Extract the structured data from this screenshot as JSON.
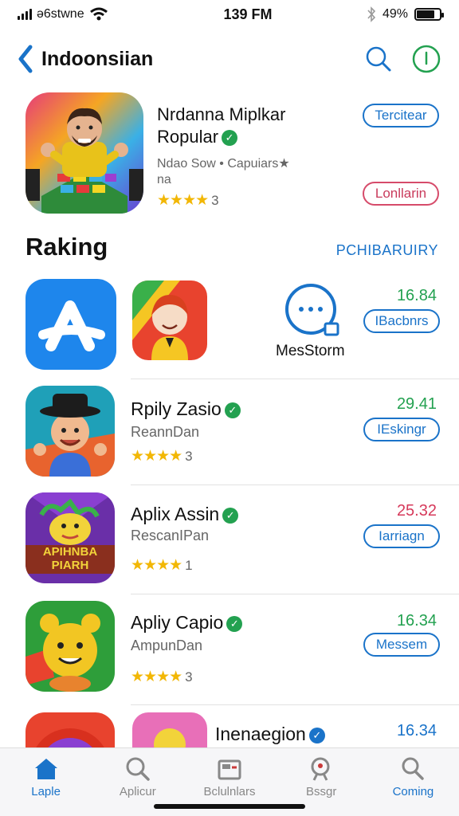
{
  "status": {
    "carrier": "ǝ6stwne",
    "time": "139 FM",
    "battery": "49%"
  },
  "nav": {
    "title": "Indoonsiian"
  },
  "featured": {
    "name_line1": "Nrdanna Miplkar",
    "name_line2": "Ropular",
    "subtitle": "Ndao Sow • Capuiars★",
    "subtitle2": "na",
    "stars": "★★★★",
    "rating": "3",
    "button_top": "Tercitear",
    "button_bottom": "Lonllarin"
  },
  "section": {
    "title": "Raking",
    "link": "PCHIBARUIRY"
  },
  "rows": [
    {
      "name": "MesStorm",
      "price": "16.84",
      "button": "IBacbnrs"
    },
    {
      "name": "Rpily Zasio",
      "developer": "ReannDan",
      "stars": "★★★★",
      "rating": "3",
      "price": "29.41",
      "button": "IEskingr"
    },
    {
      "name": "Aplix Assin",
      "developer": "RescanIPan",
      "stars": "★★★★",
      "rating": "1",
      "price": "25.32",
      "button": "Iarriagn",
      "icon_text_1": "APIHNBA",
      "icon_text_2": "PIARH"
    },
    {
      "name": "Apliy Capio",
      "developer": "AmpunDan",
      "stars": "★★★★",
      "rating": "3",
      "price": "16.34",
      "button": "Messem"
    },
    {
      "name": "Inenaegion",
      "price": "16.34"
    }
  ],
  "tabs": [
    {
      "label": "Laple",
      "icon": "home-icon"
    },
    {
      "label": "Aplicur",
      "icon": "search-icon"
    },
    {
      "label": "Bclulnlars",
      "icon": "folder-icon"
    },
    {
      "label": "Bssgr",
      "icon": "person-search-icon"
    },
    {
      "label": "Coming",
      "icon": "search-icon"
    }
  ],
  "colors": {
    "accent": "#1a73c9",
    "price_green": "#23a150",
    "price_red": "#d63a5b",
    "star": "#f2b705"
  }
}
